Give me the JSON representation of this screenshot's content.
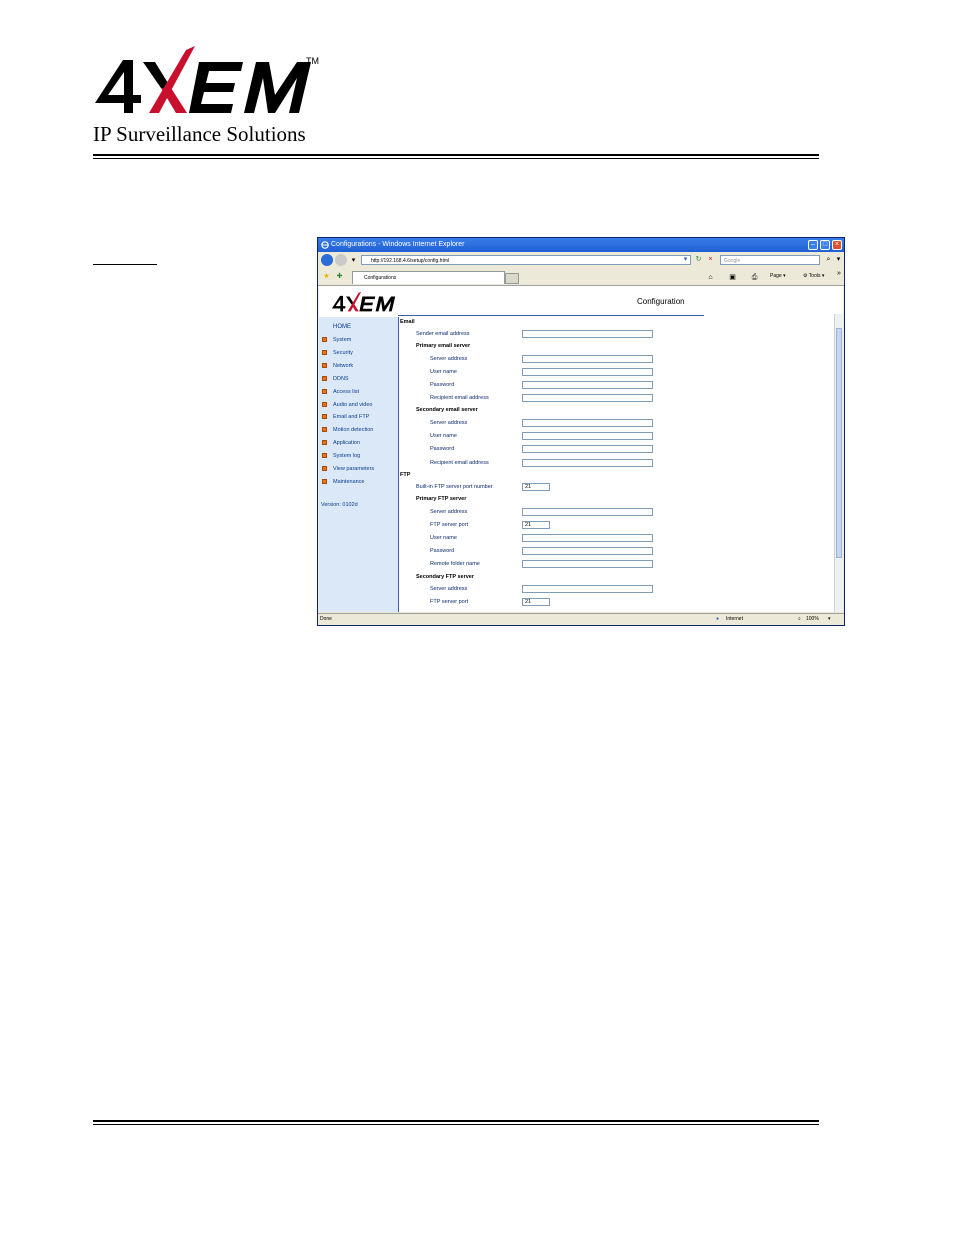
{
  "doc": {
    "brand_logo": "4XEM",
    "trademark": "TM",
    "tagline": "IP Surveillance Solutions"
  },
  "browser": {
    "window_title": "Configurations - Windows Internet Explorer",
    "address": "http://192.168.4.6/setup/config.html",
    "search_placeholder": "Google",
    "tab_label": "Configurations",
    "toolbar": {
      "page_label": "Page",
      "tools_label": "Tools",
      "more": "»"
    },
    "status": {
      "left": "Done",
      "zone": "Internet",
      "zoom": "100%"
    }
  },
  "app": {
    "logo": "4XEM",
    "page_title": "Configuration",
    "sidebar": {
      "home": "HOME",
      "items": [
        "System",
        "Security",
        "Network",
        "DDNS",
        "Access list",
        "Audio and video",
        "Email and FTP",
        "Motion detection",
        "Application",
        "System log",
        "View parameters",
        "Maintenance"
      ],
      "version": "Version: 0102d"
    },
    "form": {
      "email_header": "Email",
      "sender_label": "Sender email address",
      "primary_email_header": "Primary email server",
      "p_server_label": "Server address",
      "p_user_label": "User name",
      "p_pass_label": "Password",
      "p_recipient_label": "Recipient email address",
      "secondary_email_header": "Secondary email server",
      "s_server_label": "Server address",
      "s_user_label": "User name",
      "s_pass_label": "Password",
      "s_recipient_label": "Recipient email address",
      "ftp_header": "FTP",
      "builtin_port_label": "Built-in FTP server port number",
      "builtin_port_value": "21",
      "primary_ftp_header": "Primary FTP server",
      "pf_server_label": "Server address",
      "pf_port_label": "FTP server port",
      "pf_port_value": "21",
      "pf_user_label": "User name",
      "pf_pass_label": "Password",
      "pf_folder_label": "Remote folder name",
      "secondary_ftp_header": "Secondary FTP server",
      "sf_server_label": "Server address",
      "sf_port_label": "FTP server port",
      "sf_port_value": "21"
    }
  },
  "colors": {
    "brand_red": "#c8102e",
    "link_blue": "#0b3c8c",
    "sidebar_bg": "#dbe8f8"
  }
}
